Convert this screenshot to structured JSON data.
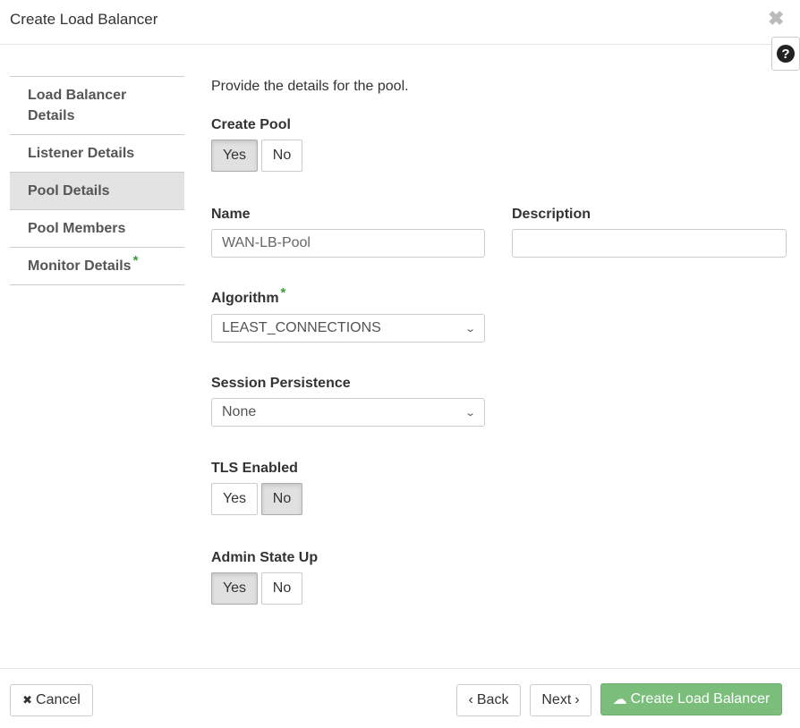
{
  "modal": {
    "title": "Create Load Balancer",
    "close_glyph": "✖",
    "help_glyph": "?"
  },
  "nav": {
    "items": [
      {
        "label": "Load Balancer Details"
      },
      {
        "label": "Listener Details"
      },
      {
        "label": "Pool Details",
        "active": true
      },
      {
        "label": "Pool Members"
      },
      {
        "label": "Monitor Details",
        "required_mark": "*"
      }
    ]
  },
  "form": {
    "intro": "Provide the details for the pool.",
    "create_pool": {
      "label": "Create Pool",
      "yes": "Yes",
      "no": "No",
      "selected": "Yes"
    },
    "name": {
      "label": "Name",
      "value": "WAN-LB-Pool"
    },
    "description": {
      "label": "Description",
      "value": ""
    },
    "algorithm": {
      "label": "Algorithm",
      "required_mark": "*",
      "value": "LEAST_CONNECTIONS"
    },
    "session_persistence": {
      "label": "Session Persistence",
      "value": "None"
    },
    "tls_enabled": {
      "label": "TLS Enabled",
      "yes": "Yes",
      "no": "No",
      "selected": "No"
    },
    "admin_state_up": {
      "label": "Admin State Up",
      "yes": "Yes",
      "no": "No",
      "selected": "Yes"
    }
  },
  "footer": {
    "cancel_label": "Cancel",
    "cancel_glyph": "✖",
    "back_label": "Back",
    "back_glyph": "‹",
    "next_label": "Next",
    "next_glyph": "›",
    "create_label": "Create Load Balancer",
    "create_glyph": "☁"
  },
  "colors": {
    "required_star": "#3c9b3c",
    "primary_button": "#7bbd7b",
    "active_nav": "#e3e3e3",
    "active_toggle": "#e0e0e0"
  }
}
